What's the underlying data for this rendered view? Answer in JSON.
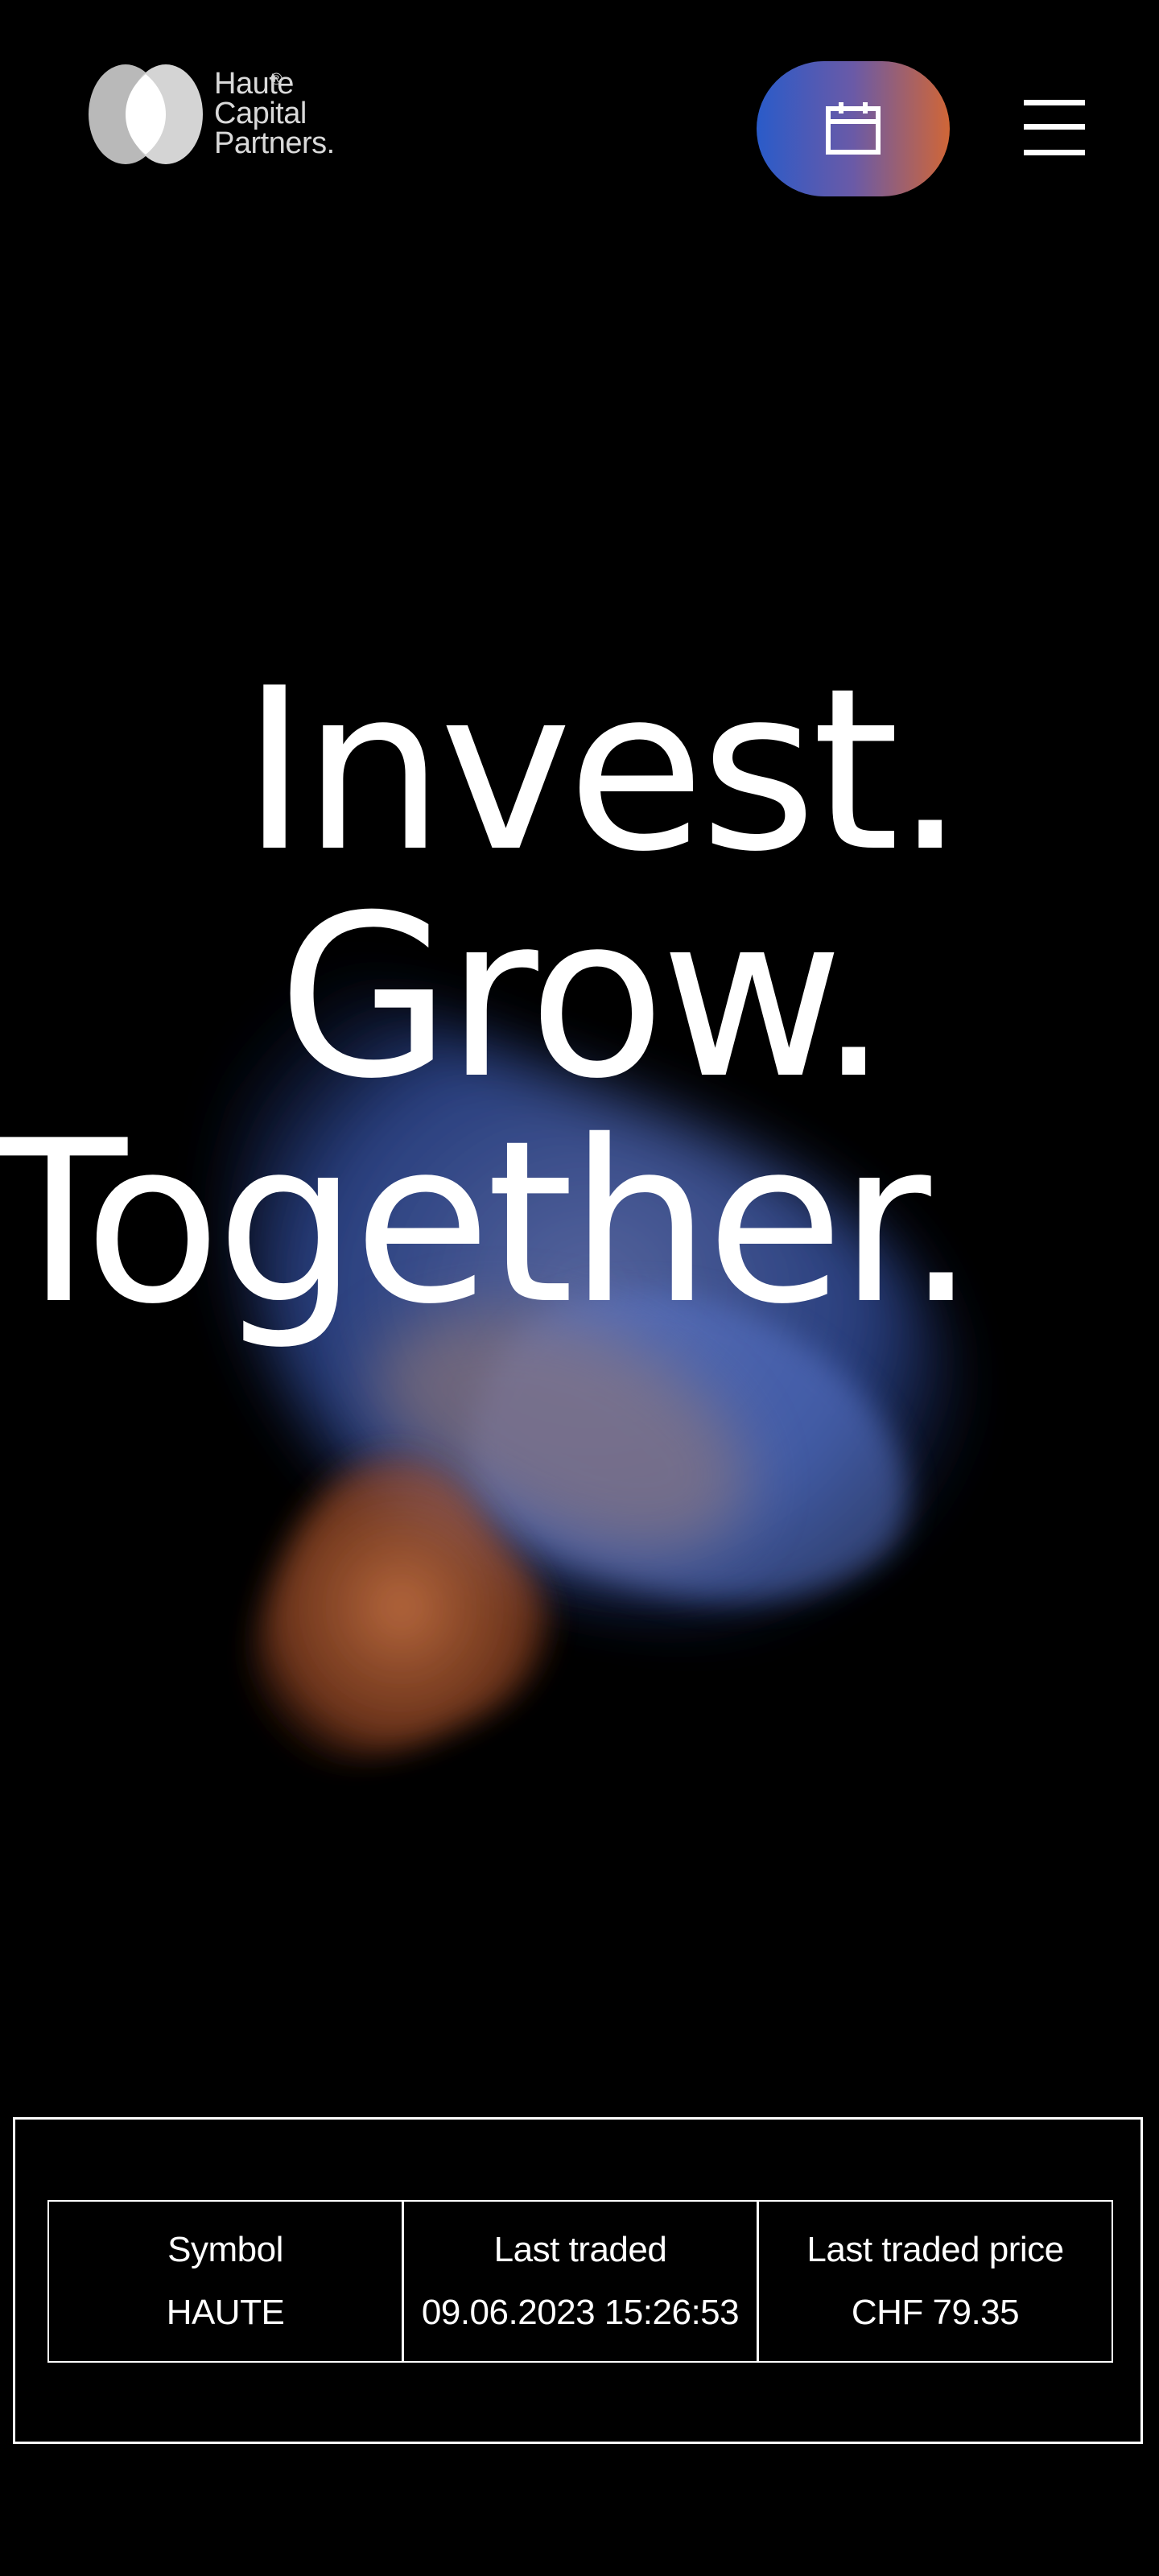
{
  "brand": {
    "name_lines": [
      "Haute",
      "Capital",
      "Partners."
    ],
    "registered_mark": "®",
    "colors": {
      "blue": "#2a5bc9",
      "orange": "#d06637",
      "logo_grey": "#c9c9c9"
    }
  },
  "header": {
    "calendar_icon": "calendar-icon",
    "menu_icon": "hamburger-menu-icon"
  },
  "hero": {
    "headline": [
      "Invest.",
      "Grow.",
      "Together."
    ]
  },
  "ticker": {
    "columns": [
      {
        "label": "Symbol",
        "value": "HAUTE"
      },
      {
        "label": "Last traded",
        "value": "09.06.2023 15:26:53"
      },
      {
        "label": "Last traded price",
        "value": "CHF 79.35"
      }
    ]
  }
}
